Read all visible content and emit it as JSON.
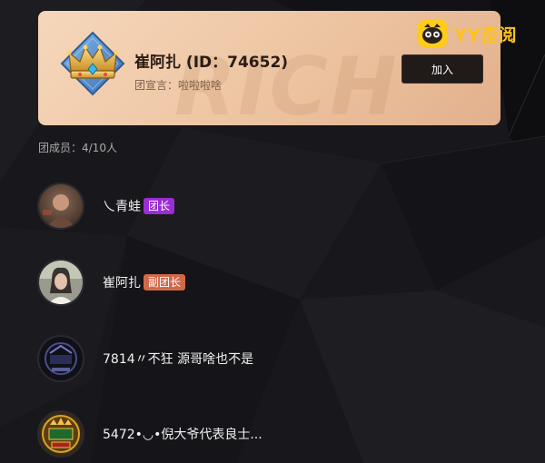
{
  "brand": {
    "name": "YY歪阅",
    "icon": "yy-logo-icon",
    "color": "#ffc414"
  },
  "group": {
    "title": "崔阿扎 (ID：74652)",
    "motto": "团宣言：啦啦啦啥",
    "watermark": "RICH",
    "join_label": "加入"
  },
  "members": {
    "count_label": "团成员：4/10人",
    "list": [
      {
        "name": "乀青蛙",
        "badge": "团长",
        "badge_type": "leader",
        "badge_color": "#9b2dd6"
      },
      {
        "name": "崔阿扎",
        "badge": "副团长",
        "badge_type": "vice",
        "badge_color": "#d2684a"
      },
      {
        "name": "7814〃不狂 源哥啥也不是",
        "badge": "",
        "badge_type": ""
      },
      {
        "name": "5472•◡•倪大爷代表良士...",
        "badge": "",
        "badge_type": ""
      }
    ]
  },
  "colors": {
    "card": "#edc4a1",
    "background": "#17161a",
    "button": "#201a18"
  }
}
